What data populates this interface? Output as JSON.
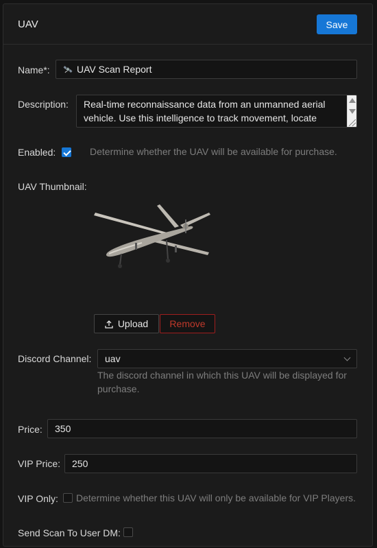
{
  "header": {
    "title": "UAV",
    "save_label": "Save"
  },
  "form": {
    "name": {
      "label": "Name*:",
      "value": "UAV Scan Report",
      "icon": "satellite-icon"
    },
    "description": {
      "label": "Description:",
      "value": "Real-time reconnaissance data from an unmanned aerial vehicle. Use this intelligence to track movement, locate"
    },
    "enabled": {
      "label": "Enabled:",
      "checked": true,
      "help": "Determine whether the UAV will be available for purchase."
    },
    "thumbnail": {
      "label": "UAV Thumbnail:",
      "upload_label": "Upload",
      "remove_label": "Remove"
    },
    "discord_channel": {
      "label": "Discord Channel:",
      "value": "uav",
      "help": "The discord channel in which this UAV will be displayed for purchase."
    },
    "price": {
      "label": "Price:",
      "value": "350"
    },
    "vip_price": {
      "label": "VIP Price:",
      "value": "250"
    },
    "vip_only": {
      "label": "VIP Only:",
      "checked": false,
      "help": "Determine whether this UAV will only be available for VIP Players."
    },
    "send_scan_dm": {
      "label": "Send Scan To User DM:",
      "checked": false
    }
  },
  "colors": {
    "accent": "#1677d6",
    "danger": "#c0392b",
    "background": "#1b1b1b"
  }
}
